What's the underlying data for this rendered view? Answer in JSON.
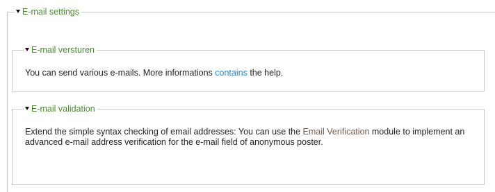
{
  "fieldset": {
    "title": "E-mail settings"
  },
  "sending": {
    "title": "E-mail versturen",
    "text_before": "You can send various e-mails. More informations ",
    "link": "contains",
    "text_after": " the help."
  },
  "validation": {
    "title": "E-mail validation",
    "text_before": "Extend the simple syntax checking of email addresses: You can use the ",
    "link": "Email Verification",
    "text_after": " module to implement an advanced e-mail address verification for the e-mail field of anonymous poster."
  },
  "colors": {
    "legend": "#4b8a33",
    "link_help": "#2b7fcf",
    "link_module": "#7a5a4a",
    "border": "#c9c9c9"
  },
  "icons": {
    "collapse": "caret-down-icon"
  }
}
